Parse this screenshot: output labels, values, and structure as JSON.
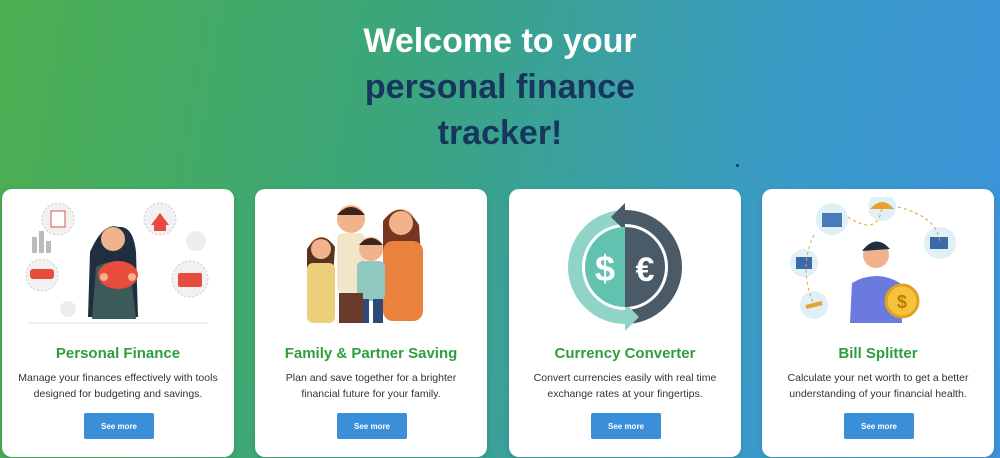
{
  "hero": {
    "line1": "Welcome to your",
    "line2": "personal finance",
    "line3": "tracker!"
  },
  "cards": [
    {
      "title": "Personal Finance",
      "desc": "Manage your finances effectively with tools designed for budgeting and savings.",
      "button": "See more",
      "icon": "piggy-bank-woman-illustration"
    },
    {
      "title": "Family & Partner Saving",
      "desc": "Plan and save together for a brighter financial future for your family.",
      "button": "See more",
      "icon": "family-hug-illustration"
    },
    {
      "title": "Currency Converter",
      "desc": "Convert currencies easily with real time exchange rates at your fingertips.",
      "button": "See more",
      "icon": "dollar-euro-exchange-icon"
    },
    {
      "title": "Bill Splitter",
      "desc": "Calculate your net worth to get a better understanding of your financial health.",
      "button": "See more",
      "icon": "man-with-coin-illustration"
    }
  ],
  "colors": {
    "title_green": "#2e9e3e",
    "button_blue": "#3a8fd8",
    "hero_dark": "#17365d"
  }
}
